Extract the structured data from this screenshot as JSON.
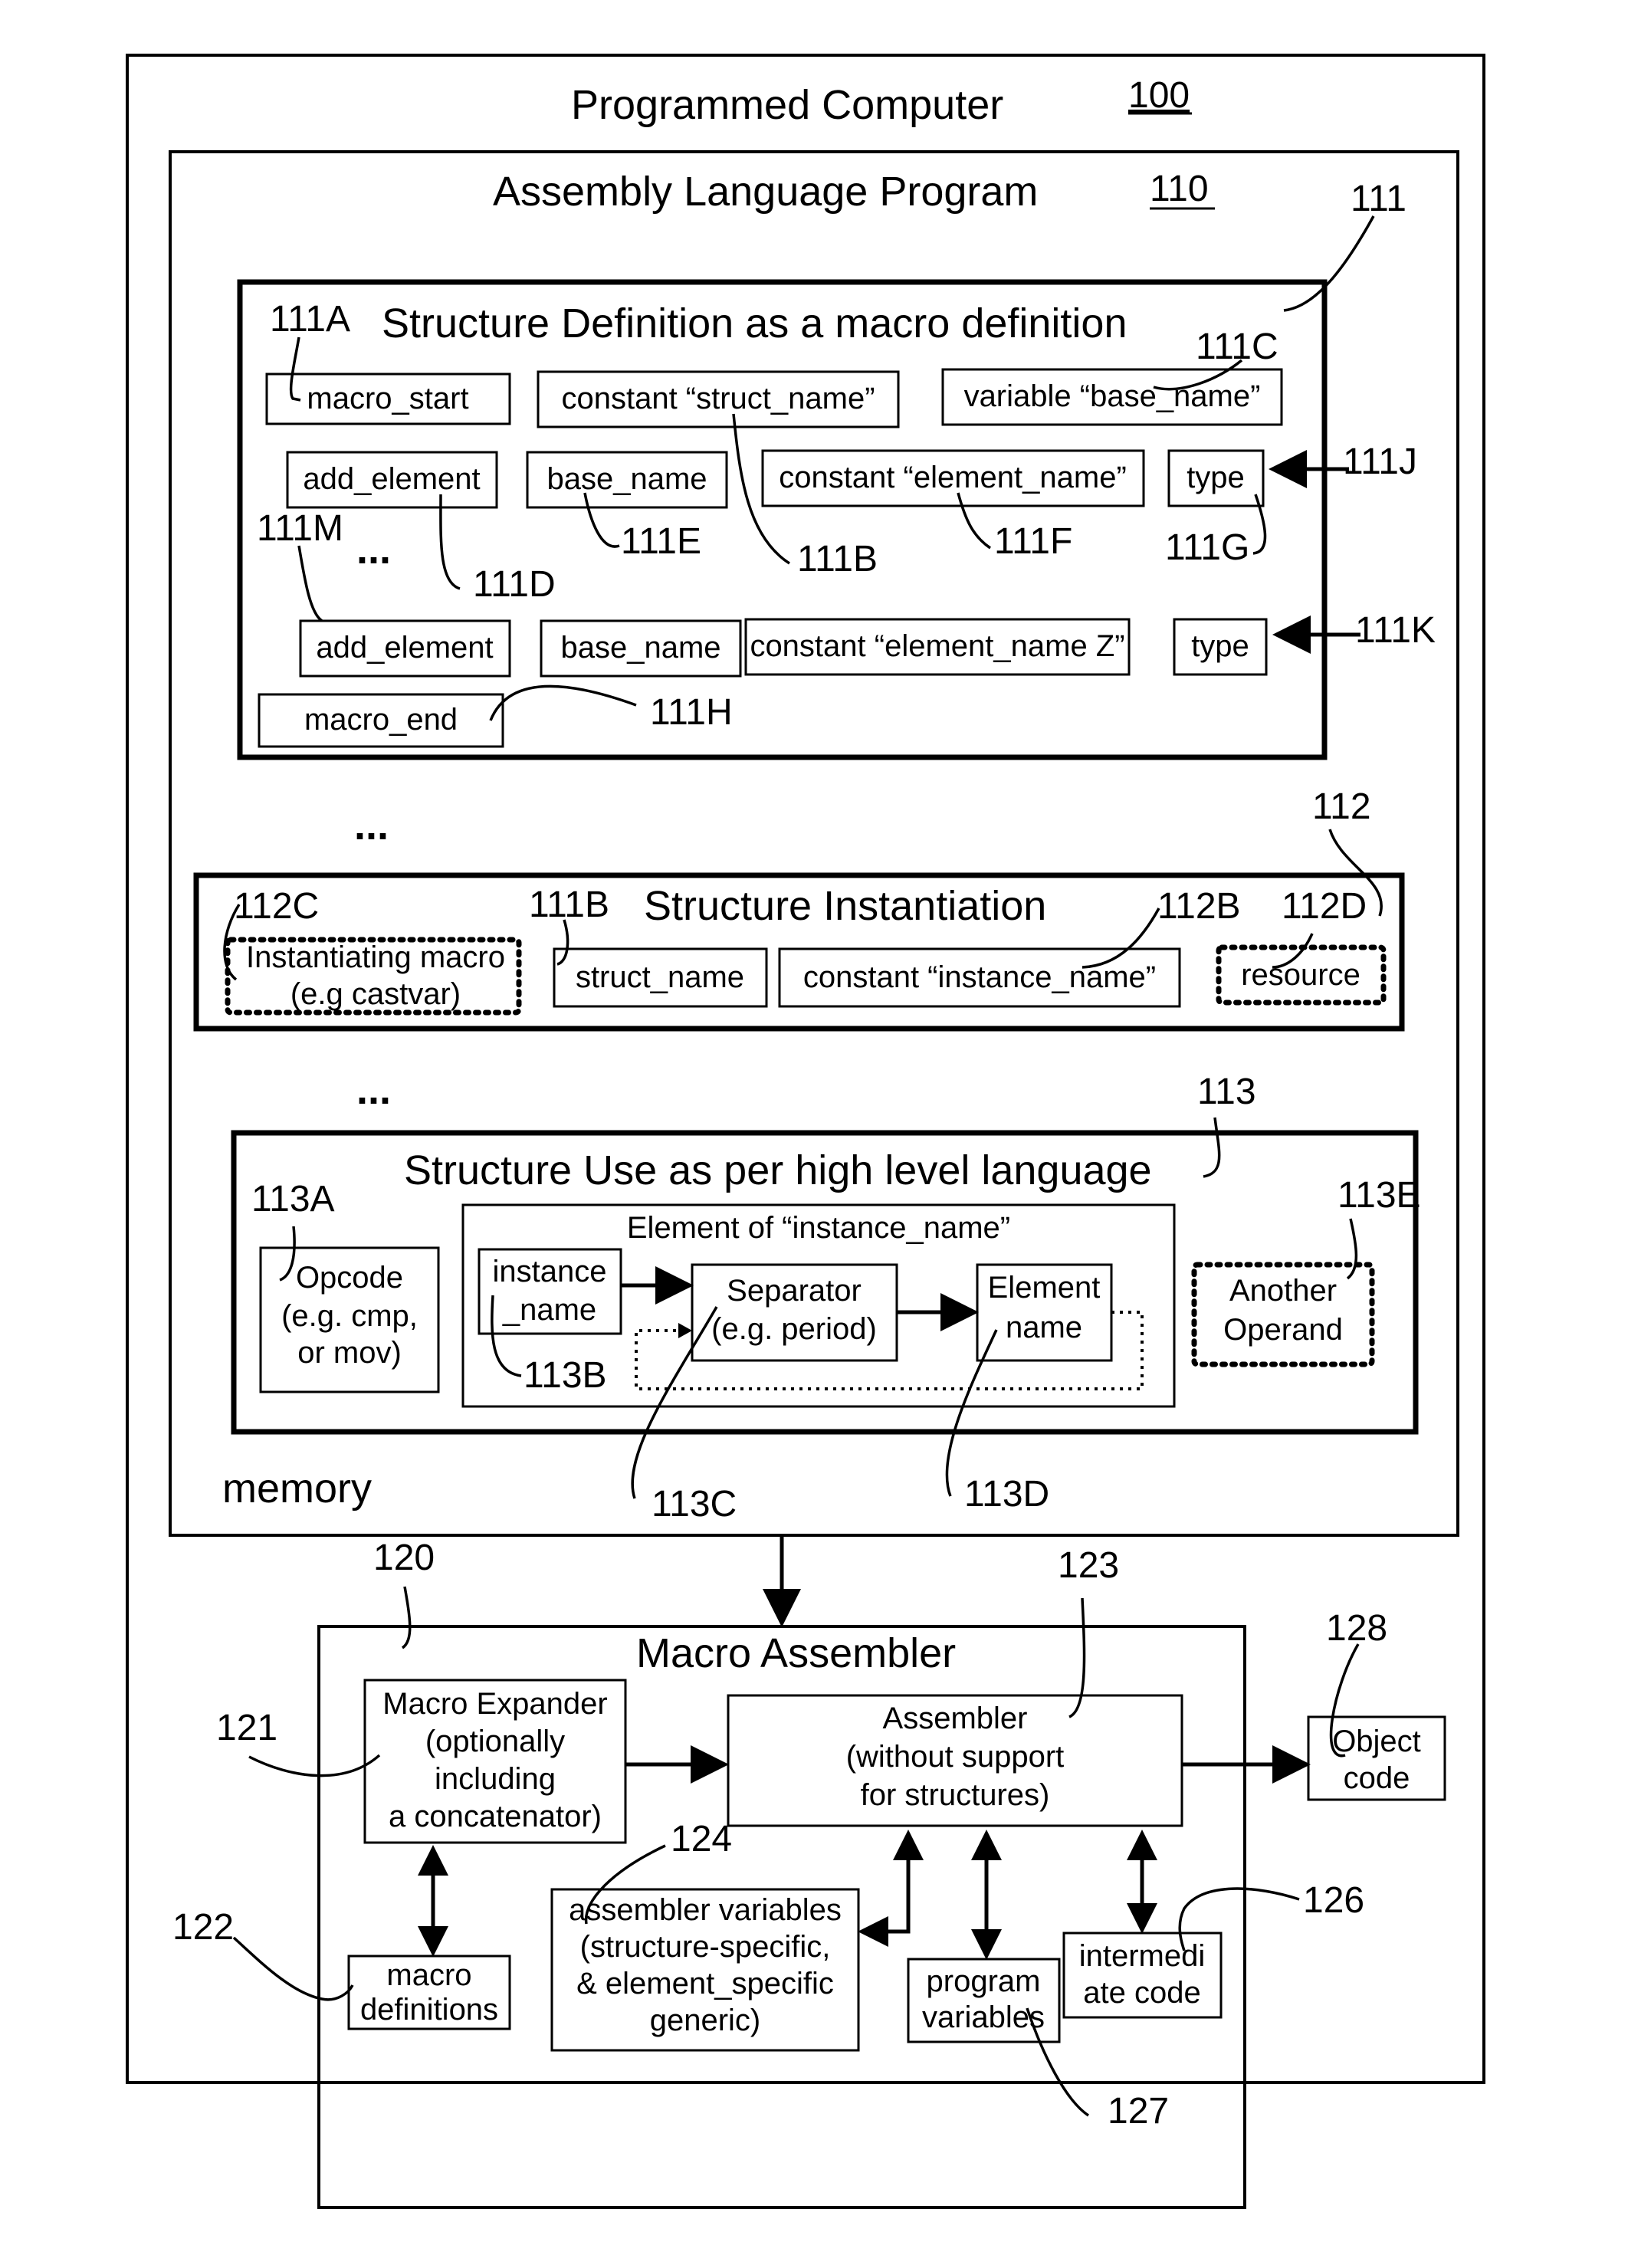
{
  "computer": {
    "title": "Programmed Computer",
    "ref": "100"
  },
  "program": {
    "title": "Assembly Language Program",
    "ref": "110",
    "memory_label": "memory"
  },
  "ellipsis": "...",
  "structure_definition": {
    "ref": "111",
    "title": "Structure Definition as a macro definition",
    "boxes": {
      "macro_start": "macro_start",
      "const_struct": "constant “struct_name”",
      "var_base": "variable “base_name”",
      "add_element_1": "add_element",
      "base_name_1": "base_name",
      "const_element_1": "constant “element_name”",
      "type_1": "type",
      "add_element_2": "add_element",
      "base_name_2": "base_name",
      "const_element_2": "constant “element_name Z”",
      "type_2": "type",
      "macro_end": "macro_end"
    },
    "refs": {
      "a": "111A",
      "b": "111B",
      "c": "111C",
      "d": "111D",
      "e": "111E",
      "f": "111F",
      "g": "111G",
      "h": "111H",
      "j": "111J",
      "k": "111K",
      "m": "111M"
    }
  },
  "structure_instantiation": {
    "ref": "112",
    "title": "Structure Instantiation",
    "instantiating_macro": [
      "Instantiating macro",
      "(e.g castvar)"
    ],
    "struct_name": "struct_name",
    "const_instance": "constant “instance_name”",
    "resource": "resource",
    "refs": {
      "c": "112C",
      "b111": "111B",
      "b": "112B",
      "d": "112D"
    }
  },
  "structure_use": {
    "ref": "113",
    "title": "Structure Use as per high level language",
    "opcode": [
      "Opcode",
      "(e.g. cmp,",
      "or mov)"
    ],
    "element_group_title": "Element of “instance_name”",
    "instance_name": [
      "instance",
      "_name"
    ],
    "separator": [
      "Separator",
      "(e.g. period)"
    ],
    "element_name": [
      "Element",
      "name"
    ],
    "another_operand": [
      "Another",
      "Operand"
    ],
    "refs": {
      "a": "113A",
      "b": "113B",
      "c": "113C",
      "d": "113D",
      "e": "113E"
    }
  },
  "macro_assembler": {
    "ref": "120",
    "title": "Macro Assembler",
    "macro_expander": {
      "ref": "121",
      "lines": [
        "Macro Expander",
        "(optionally",
        "including",
        "a concatenator)"
      ]
    },
    "macro_definitions": {
      "ref": "122",
      "lines": [
        "macro",
        "definitions"
      ]
    },
    "assembler": {
      "ref": "123",
      "lines": [
        "Assembler",
        "(without support",
        "for structures)"
      ]
    },
    "assembler_variables": {
      "ref": "124",
      "lines": [
        "assembler variables",
        "(structure-specific,",
        "& element_specific",
        "generic)"
      ]
    },
    "intermediate_code": {
      "ref": "126",
      "lines": [
        "intermedi",
        "ate code"
      ]
    },
    "program_variables": {
      "ref": "127",
      "lines": [
        "program",
        "variables"
      ]
    },
    "object_code": {
      "ref": "128",
      "lines": [
        "Object",
        "code"
      ]
    }
  }
}
